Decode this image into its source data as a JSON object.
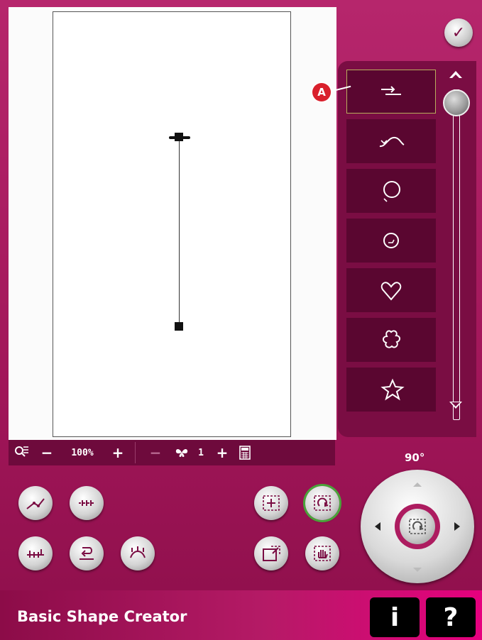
{
  "app": {
    "title": "Basic Shape Creator"
  },
  "zoom": {
    "value": "100%",
    "minus": "−",
    "plus": "+"
  },
  "repeat": {
    "value": "1",
    "minus": "−",
    "plus": "+"
  },
  "rotation": {
    "angle": "90°"
  },
  "callout": {
    "label": "A"
  },
  "buttons": {
    "ok": "✓",
    "info": "i",
    "help": "?"
  },
  "stitch_list": {
    "items": [
      {
        "icon": "straight-stitch-icon",
        "selected": true
      },
      {
        "icon": "wave-stitch-icon"
      },
      {
        "icon": "circle-stitch-icon"
      },
      {
        "icon": "spiral-stitch-icon"
      },
      {
        "icon": "heart-stitch-icon"
      },
      {
        "icon": "flower-stitch-icon"
      },
      {
        "icon": "star-stitch-icon"
      }
    ]
  },
  "colors": {
    "accent": "#a8155c",
    "panel": "#7a0d43",
    "item": "#5a0630",
    "active_ring": "#4aa43a"
  }
}
